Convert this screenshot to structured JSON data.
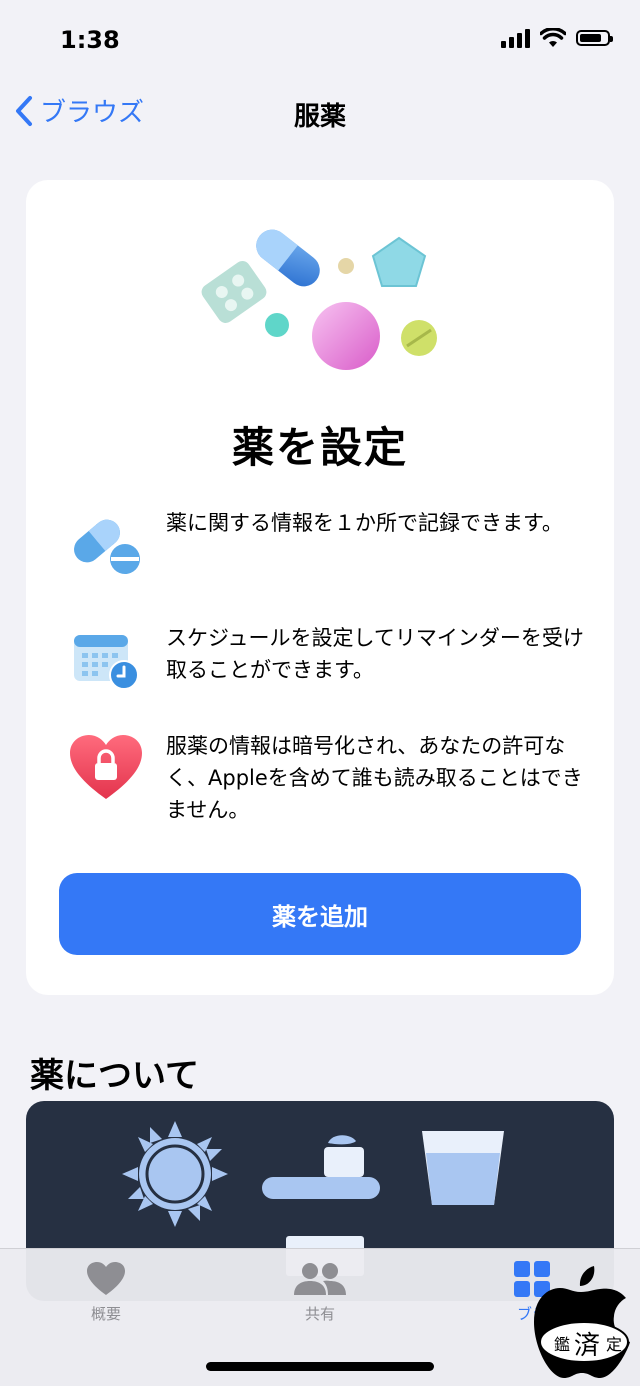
{
  "status_bar": {
    "time": "1:38"
  },
  "nav": {
    "back_label": "ブラウズ",
    "title": "服薬"
  },
  "setup_card": {
    "title": "薬を設定",
    "features": [
      {
        "icon": "pill-icon",
        "text": "薬に関する情報を１か所で記録できます。"
      },
      {
        "icon": "calendar-clock-icon",
        "text": "スケジュールを設定してリマインダーを受け取ることができます。"
      },
      {
        "icon": "heart-lock-icon",
        "text": "服薬の情報は暗号化され、あなたの許可なく、Appleを含めて誰も読み取ることはできません。"
      }
    ],
    "add_button_label": "薬を追加"
  },
  "about": {
    "section_title": "薬について"
  },
  "tab_bar": {
    "tabs": [
      {
        "label": "概要",
        "icon": "heart-icon",
        "active": false
      },
      {
        "label": "共有",
        "icon": "people-icon",
        "active": false
      },
      {
        "label": "ブラ",
        "icon": "grid-icon",
        "active": true
      }
    ]
  },
  "overlay_mark": {
    "text_left": "鑑",
    "text_center": "済",
    "text_right": "定"
  },
  "colors": {
    "accent": "#3478f6",
    "background": "#f2f2f7",
    "about_card": "#263042"
  }
}
